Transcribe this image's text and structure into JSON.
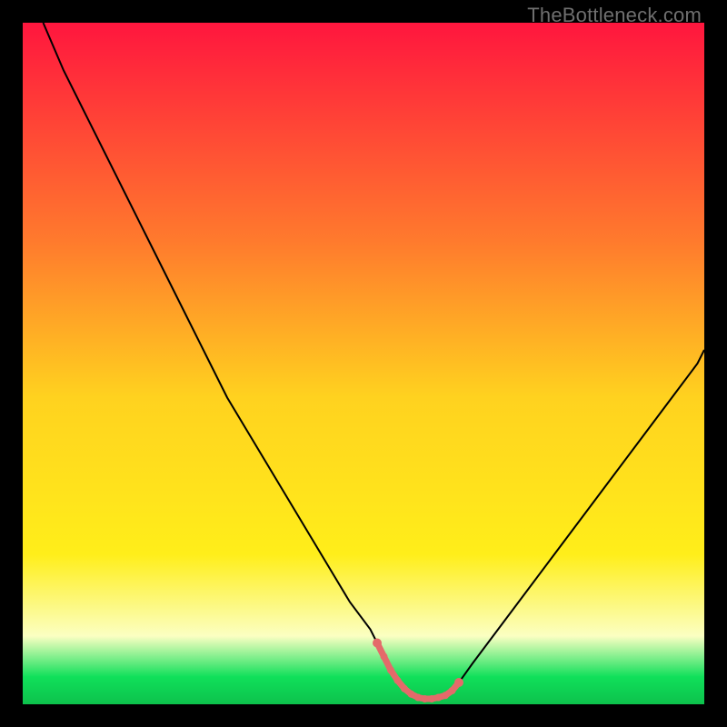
{
  "watermark": "TheBottleneck.com",
  "colors": {
    "frame": "#000000",
    "gradient_top": "#ff163e",
    "gradient_mid_upper": "#ff7a2d",
    "gradient_mid": "#ffd21f",
    "gradient_mid_lower": "#ffee1a",
    "gradient_pale": "#fbffc2",
    "gradient_green": "#10e05a",
    "curve": "#000000",
    "marker": "#e46a6a"
  },
  "chart_data": {
    "type": "line",
    "title": "",
    "xlabel": "",
    "ylabel": "",
    "xlim": [
      0,
      100
    ],
    "ylim": [
      0,
      100
    ],
    "x": [
      3,
      6,
      9,
      12,
      15,
      18,
      21,
      24,
      27,
      30,
      33,
      36,
      39,
      42,
      45,
      48,
      51,
      52,
      53,
      54,
      55,
      56,
      57,
      58,
      59,
      60,
      61,
      62,
      63,
      64,
      66,
      69,
      72,
      75,
      78,
      81,
      84,
      87,
      90,
      93,
      96,
      99,
      100
    ],
    "values": [
      100,
      93,
      87,
      81,
      75,
      69,
      63,
      57,
      51,
      45,
      40,
      35,
      30,
      25,
      20,
      15,
      11,
      9,
      7,
      5,
      3.5,
      2.3,
      1.5,
      1,
      0.8,
      0.8,
      1,
      1.3,
      2,
      3.2,
      6,
      10,
      14,
      18,
      22,
      26,
      30,
      34,
      38,
      42,
      46,
      50,
      52
    ],
    "markers_x": [
      52,
      53,
      54,
      55,
      56,
      57,
      58,
      59,
      60,
      61,
      62,
      63,
      64
    ],
    "markers_y": [
      9,
      7,
      5,
      3.5,
      2.3,
      1.5,
      1,
      0.8,
      0.8,
      1,
      1.3,
      2,
      3.2
    ]
  }
}
